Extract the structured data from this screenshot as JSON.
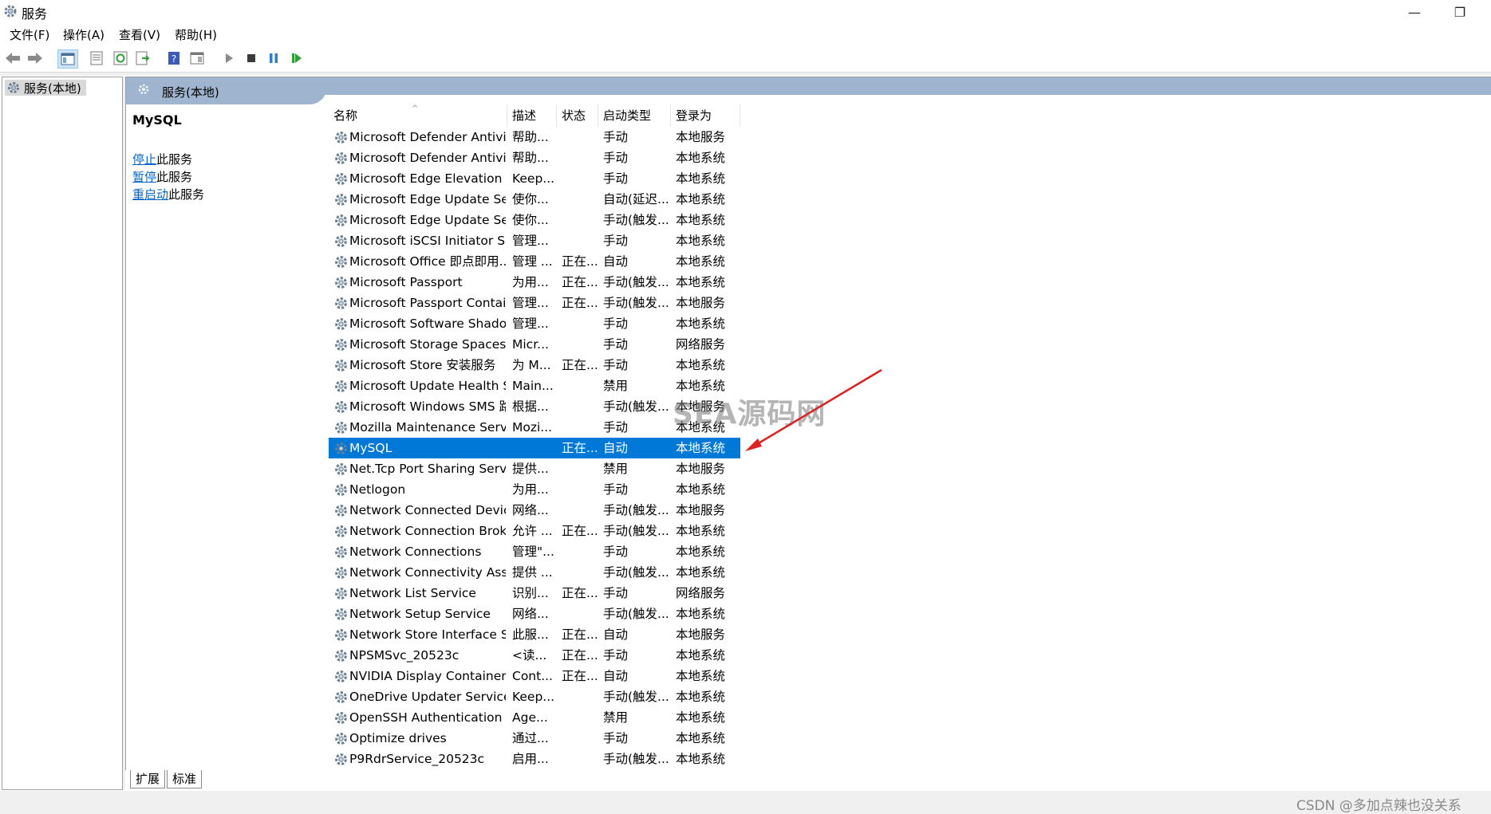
{
  "window": {
    "title": "服务",
    "minimize": "—",
    "restore": "❐"
  },
  "menu": [
    "文件(F)",
    "操作(A)",
    "查看(V)",
    "帮助(H)"
  ],
  "tree": {
    "root_label": "服务(本地)"
  },
  "panel": {
    "header_title": "服务(本地)"
  },
  "detail": {
    "service_name": "MySQL",
    "actions": [
      {
        "link": "停止",
        "suffix": "此服务"
      },
      {
        "link": "暂停",
        "suffix": "此服务"
      },
      {
        "link": "重启动",
        "suffix": "此服务"
      }
    ]
  },
  "columns": {
    "name": "名称",
    "desc": "描述",
    "status": "状态",
    "startup": "启动类型",
    "logon": "登录为"
  },
  "rows": [
    {
      "name": "Microsoft Defender Antivir...",
      "desc": "帮助...",
      "status": "",
      "startup": "手动",
      "logon": "本地服务"
    },
    {
      "name": "Microsoft Defender Antivir...",
      "desc": "帮助...",
      "status": "",
      "startup": "手动",
      "logon": "本地系统"
    },
    {
      "name": "Microsoft Edge Elevation S...",
      "desc": "Keep...",
      "status": "",
      "startup": "手动",
      "logon": "本地系统"
    },
    {
      "name": "Microsoft Edge Update Ser...",
      "desc": "使你...",
      "status": "",
      "startup": "自动(延迟...",
      "logon": "本地系统"
    },
    {
      "name": "Microsoft Edge Update Ser...",
      "desc": "使你...",
      "status": "",
      "startup": "手动(触发...",
      "logon": "本地系统"
    },
    {
      "name": "Microsoft iSCSI Initiator Ser...",
      "desc": "管理...",
      "status": "",
      "startup": "手动",
      "logon": "本地系统"
    },
    {
      "name": "Microsoft Office 即点即用...",
      "desc": "管理 ...",
      "status": "正在...",
      "startup": "自动",
      "logon": "本地系统"
    },
    {
      "name": "Microsoft Passport",
      "desc": "为用...",
      "status": "正在...",
      "startup": "手动(触发...",
      "logon": "本地系统"
    },
    {
      "name": "Microsoft Passport Container",
      "desc": "管理...",
      "status": "正在...",
      "startup": "手动(触发...",
      "logon": "本地服务"
    },
    {
      "name": "Microsoft Software Shado...",
      "desc": "管理...",
      "status": "",
      "startup": "手动",
      "logon": "本地系统"
    },
    {
      "name": "Microsoft Storage Spaces S...",
      "desc": "Micr...",
      "status": "",
      "startup": "手动",
      "logon": "网络服务"
    },
    {
      "name": "Microsoft Store 安装服务",
      "desc": "为 M...",
      "status": "正在...",
      "startup": "手动",
      "logon": "本地系统"
    },
    {
      "name": "Microsoft Update Health S...",
      "desc": "Main...",
      "status": "",
      "startup": "禁用",
      "logon": "本地系统"
    },
    {
      "name": "Microsoft Windows SMS 路...",
      "desc": "根据...",
      "status": "",
      "startup": "手动(触发...",
      "logon": "本地服务"
    },
    {
      "name": "Mozilla Maintenance Service",
      "desc": "Mozi...",
      "status": "",
      "startup": "手动",
      "logon": "本地系统"
    },
    {
      "name": "MySQL",
      "desc": "",
      "status": "正在...",
      "startup": "自动",
      "logon": "本地系统",
      "selected": true
    },
    {
      "name": "Net.Tcp Port Sharing Service",
      "desc": "提供...",
      "status": "",
      "startup": "禁用",
      "logon": "本地服务"
    },
    {
      "name": "Netlogon",
      "desc": "为用...",
      "status": "",
      "startup": "手动",
      "logon": "本地系统"
    },
    {
      "name": "Network Connected Devic...",
      "desc": "网络...",
      "status": "",
      "startup": "手动(触发...",
      "logon": "本地服务"
    },
    {
      "name": "Network Connection Broker",
      "desc": "允许 ...",
      "status": "正在...",
      "startup": "手动(触发...",
      "logon": "本地系统"
    },
    {
      "name": "Network Connections",
      "desc": "管理\"...",
      "status": "",
      "startup": "手动",
      "logon": "本地系统"
    },
    {
      "name": "Network Connectivity Assis...",
      "desc": "提供 ...",
      "status": "",
      "startup": "手动(触发...",
      "logon": "本地系统"
    },
    {
      "name": "Network List Service",
      "desc": "识别...",
      "status": "正在...",
      "startup": "手动",
      "logon": "网络服务"
    },
    {
      "name": "Network Setup Service",
      "desc": "网络...",
      "status": "",
      "startup": "手动(触发...",
      "logon": "本地系统"
    },
    {
      "name": "Network Store Interface Se...",
      "desc": "此服...",
      "status": "正在...",
      "startup": "自动",
      "logon": "本地服务"
    },
    {
      "name": "NPSMSvc_20523c",
      "desc": "<读...",
      "status": "正在...",
      "startup": "手动",
      "logon": "本地系统"
    },
    {
      "name": "NVIDIA Display Container LS",
      "desc": "Cont...",
      "status": "正在...",
      "startup": "自动",
      "logon": "本地系统"
    },
    {
      "name": "OneDrive Updater Service",
      "desc": "Keep...",
      "status": "",
      "startup": "手动(触发...",
      "logon": "本地系统"
    },
    {
      "name": "OpenSSH Authentication ...",
      "desc": "Age...",
      "status": "",
      "startup": "禁用",
      "logon": "本地系统"
    },
    {
      "name": "Optimize drives",
      "desc": "通过...",
      "status": "",
      "startup": "手动",
      "logon": "本地系统"
    },
    {
      "name": "P9RdrService_20523c",
      "desc": "启用...",
      "status": "",
      "startup": "手动(触发...",
      "logon": "本地系统"
    }
  ],
  "tabs": [
    "扩展",
    "标准"
  ],
  "overlay_text": "SEA源码网",
  "footer_watermark": "CSDN @多加点辣也没关系",
  "colors": {
    "selection": "#0078d7",
    "header_band": "#9fb5cf",
    "link": "#0066cc",
    "arrow": "#e02020"
  }
}
